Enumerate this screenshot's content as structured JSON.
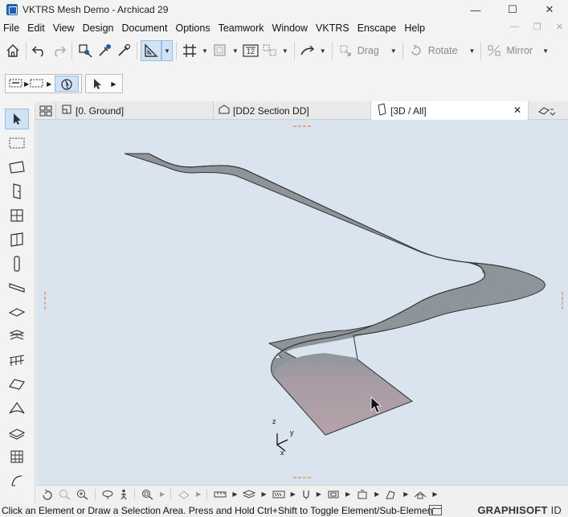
{
  "window": {
    "title": "VKTRS Mesh Demo - Archicad 29",
    "minimize": "—",
    "maximize": "☐",
    "close": "✕"
  },
  "menu": [
    "File",
    "Edit",
    "View",
    "Design",
    "Document",
    "Options",
    "Teamwork",
    "Window",
    "VKTRS",
    "Enscape",
    "Help"
  ],
  "toolbar": {
    "drag_label": "Drag",
    "rotate_label": "Rotate",
    "mirror_label": "Mirror",
    "grid_number": "12"
  },
  "tabs": [
    {
      "label": "[0. Ground]"
    },
    {
      "label": "[DD2 Section DD]"
    },
    {
      "label": "[3D / All]"
    }
  ],
  "axes": {
    "z": "z",
    "y": "y",
    "x": "x"
  },
  "status": {
    "text": "Click an Element or Draw a Selection Area. Press and Hold Ctrl+Shift to Toggle Element/Sub-Element",
    "brand": "GRAPHISOFT",
    "brand_suffix": "ID"
  },
  "colors": {
    "viewport_bg": "#d9e4ee",
    "mesh_top": "#8c949a",
    "mesh_pink": "#b2a0a8",
    "selection": "#cfe2f6"
  }
}
